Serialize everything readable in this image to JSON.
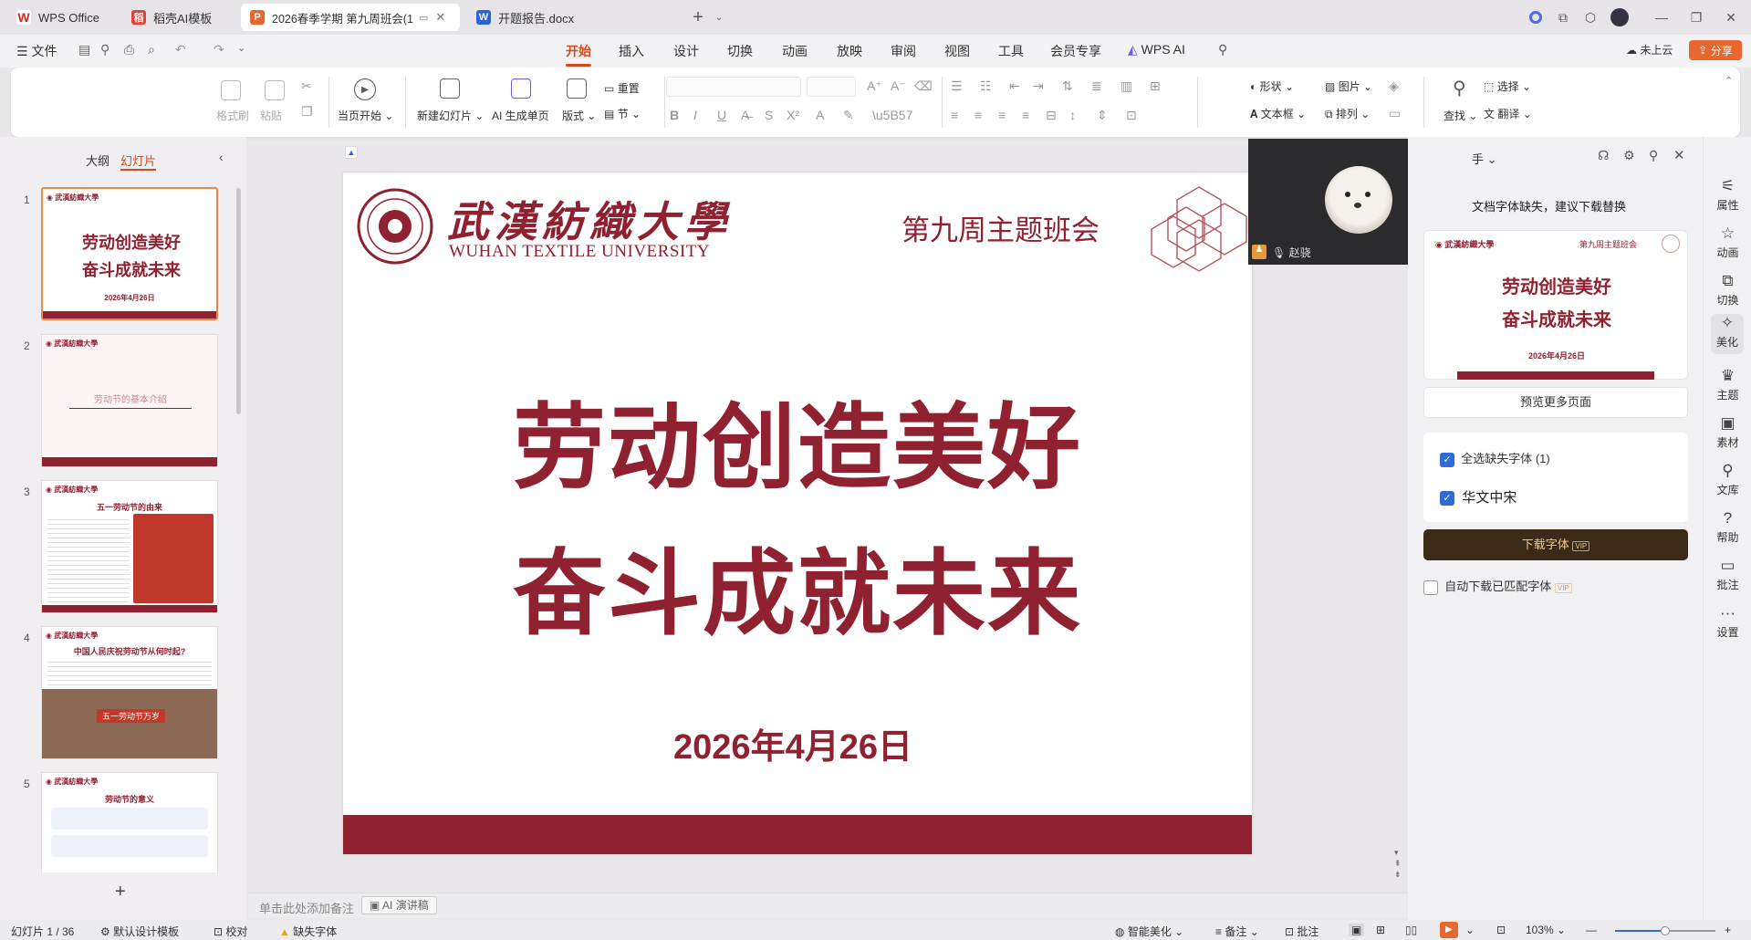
{
  "tabs": [
    {
      "label": "WPS Office",
      "icon": "wps-logo-icon",
      "color": "#d9261c"
    },
    {
      "label": "稻壳AI模板",
      "icon": "docer-icon",
      "color": "#e5413a"
    },
    {
      "label": "2026春季学期 第九周班会(1",
      "icon": "presentation-icon",
      "color": "#e8672f"
    },
    {
      "label": "开题报告.docx",
      "icon": "word-icon",
      "color": "#2b62d9"
    }
  ],
  "menubar": {
    "file": "文件",
    "items": [
      "开始",
      "插入",
      "设计",
      "切换",
      "动画",
      "放映",
      "审阅",
      "视图",
      "工具",
      "会员专享",
      "WPS AI"
    ],
    "active": "开始",
    "cloud": "未上云",
    "share": "分享"
  },
  "ribbon": {
    "format_painter": "格式刷",
    "paste": "粘贴",
    "play_from_start": "当页开始",
    "new_slide": "新建幻灯片",
    "ai_page": "AI 生成单页",
    "layout": "版式",
    "reset": "重置",
    "section": "节",
    "shape": "形状",
    "image": "图片",
    "textbox": "文本框",
    "arrange": "排列",
    "find": "查找",
    "select": "选择",
    "translate": "翻译"
  },
  "leftpanel": {
    "outline_tab": "大纲",
    "slides_tab": "幻灯片"
  },
  "thumbs": [
    {
      "num": "1",
      "line1": "劳动创造美好",
      "line2": "奋斗成就未来",
      "date": "2026年4月26日"
    },
    {
      "num": "2",
      "caption": "劳动节的基本介绍"
    },
    {
      "num": "3",
      "heading": "五一劳动节的由来"
    },
    {
      "num": "4",
      "heading": "中国人民庆祝劳动节从何时起?",
      "banner": "五一劳动节万岁"
    },
    {
      "num": "5",
      "heading": "劳动节的意义"
    }
  ],
  "slide": {
    "university_cn": "武漢紡織大學",
    "university_en": "WUHAN TEXTILE UNIVERSITY",
    "header_title": "第九周主题班会",
    "title_line1": "劳动创造美好",
    "title_line2": "奋斗成就未来",
    "date": "2026年4月26日",
    "accent_color": "#8f2130"
  },
  "notes": {
    "placeholder": "单击此处添加备注",
    "ai_button": "AI 演讲稿"
  },
  "video": {
    "name": "赵骁"
  },
  "rightpanel": {
    "title_partial": "手",
    "warning": "文档字体缺失，建议下载替换",
    "preview_title1": "劳动创造美好",
    "preview_title2": "奋斗成就未来",
    "preview_date": "2026年4月26日",
    "preview_more": "预览更多页面",
    "select_all": "全选缺失字体 (1)",
    "font_name": "华文中宋",
    "download": "下载字体",
    "auto_download": "自动下载已匹配字体"
  },
  "sidebar": [
    "属性",
    "动画",
    "切换",
    "美化",
    "主题",
    "素材",
    "文库",
    "帮助",
    "批注",
    "设置"
  ],
  "status": {
    "slide_counter": "幻灯片 1 / 36",
    "template": "默认设计模板",
    "proof": "校对",
    "missing_font": "缺失字体",
    "smart_beautify": "智能美化",
    "notes": "备注",
    "comments": "批注",
    "zoom": "103%"
  }
}
